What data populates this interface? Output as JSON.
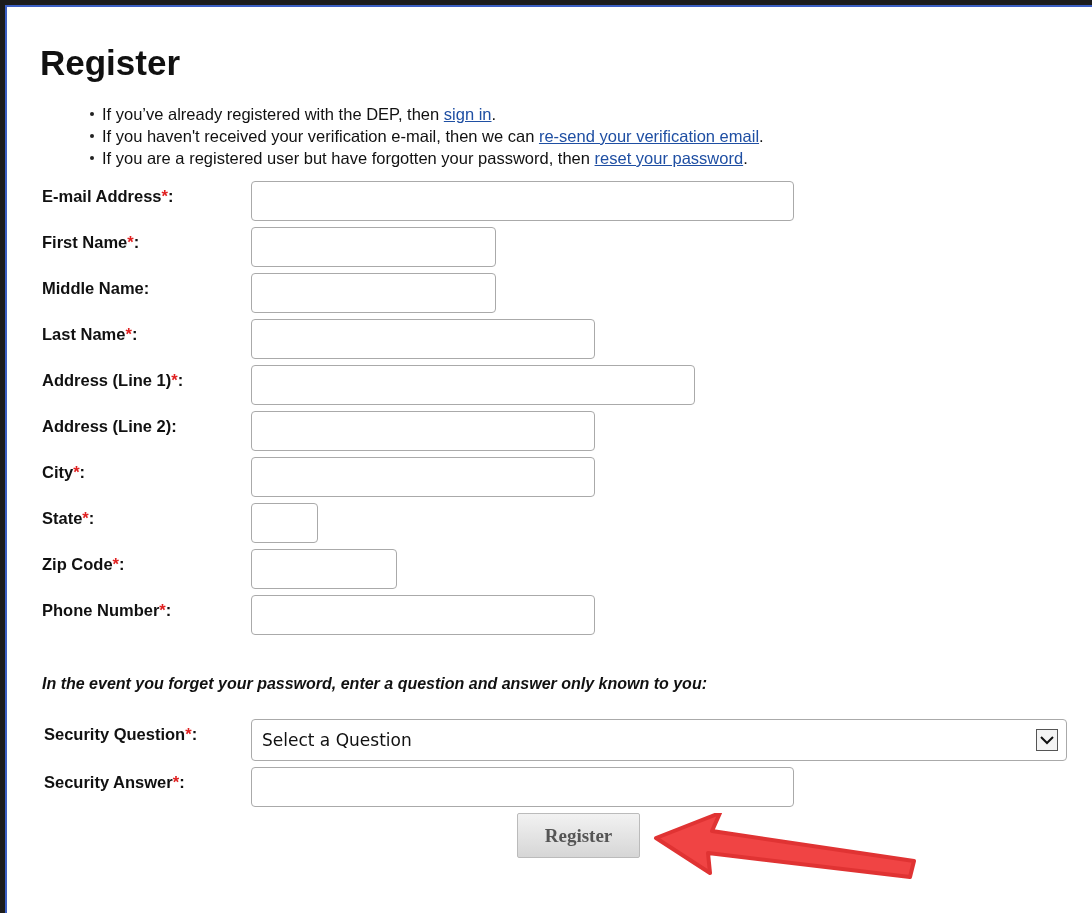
{
  "title": "Register",
  "notices": [
    {
      "before": "If you’ve already registered with the DEP, then ",
      "link": "sign in",
      "after": "."
    },
    {
      "before": "If you haven't received your verification e-mail, then we can ",
      "link": "re-send your verification email",
      "after": "."
    },
    {
      "before": "If you are a registered user but have forgotten your password, then ",
      "link": "reset your password",
      "after": "."
    }
  ],
  "fields": [
    {
      "label": "E-mail Address",
      "mark": "*",
      "suffix": ":"
    },
    {
      "label": "First Name",
      "mark": "*",
      "suffix": ":"
    },
    {
      "label": "Middle Name",
      "suffix": ":"
    },
    {
      "label": "Last Name",
      "mark": "*",
      "suffix": ":"
    },
    {
      "label": "Address (Line 1)",
      "mark": "*",
      "suffix": ":"
    },
    {
      "label": "Address (Line 2)",
      "suffix": ":"
    },
    {
      "label": "City",
      "mark": "*",
      "suffix": ":"
    },
    {
      "label": "State",
      "mark": "*",
      "suffix": ":"
    },
    {
      "label": "Zip Code",
      "mark": "*",
      "suffix": ":"
    },
    {
      "label": "Phone Number",
      "mark": "*",
      "suffix": ":"
    }
  ],
  "security_note": "In the event you forget your password, enter a question and answer only known to you:",
  "security_question": {
    "label": "Security Question",
    "mark": "*",
    "suffix": ":",
    "value": "Select a Question"
  },
  "security_answer": {
    "label": "Security Answer",
    "mark": "*",
    "suffix": ":"
  },
  "submit_button": "Register"
}
